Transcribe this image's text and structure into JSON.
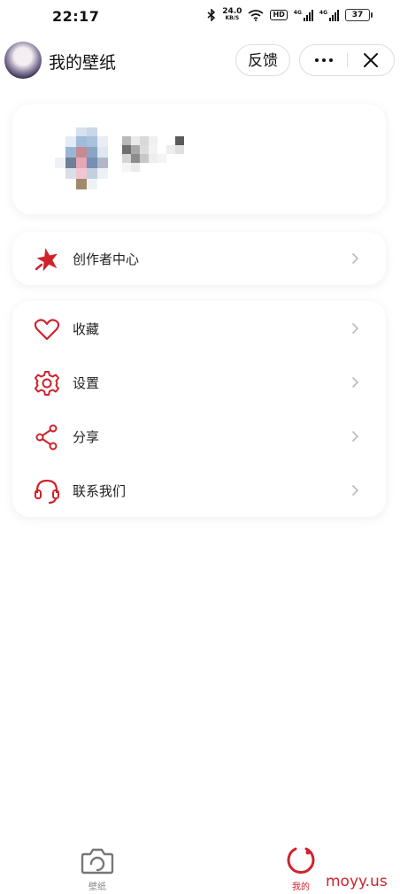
{
  "status_bar": {
    "time": "22:17",
    "net_speed": "24.0",
    "net_unit": "KB/S",
    "hd": "HD",
    "sig1": "4G",
    "sig2": "4G",
    "battery": "37"
  },
  "header": {
    "title": "我的壁纸",
    "feedback_label": "反馈"
  },
  "creator": {
    "label": "创作者中心"
  },
  "menu": {
    "items": [
      {
        "label": "收藏",
        "icon": "heart-icon"
      },
      {
        "label": "设置",
        "icon": "gear-icon"
      },
      {
        "label": "分享",
        "icon": "share-icon"
      },
      {
        "label": "联系我们",
        "icon": "headset-icon"
      }
    ]
  },
  "tabbar": {
    "tabs": [
      {
        "label": "壁纸",
        "icon": "camera-icon",
        "active": false
      },
      {
        "label": "我的",
        "icon": "profile-ring-icon",
        "active": true
      }
    ]
  },
  "watermark": "moyy.us",
  "colors": {
    "accent": "#d0222c",
    "inactive": "#888888"
  }
}
